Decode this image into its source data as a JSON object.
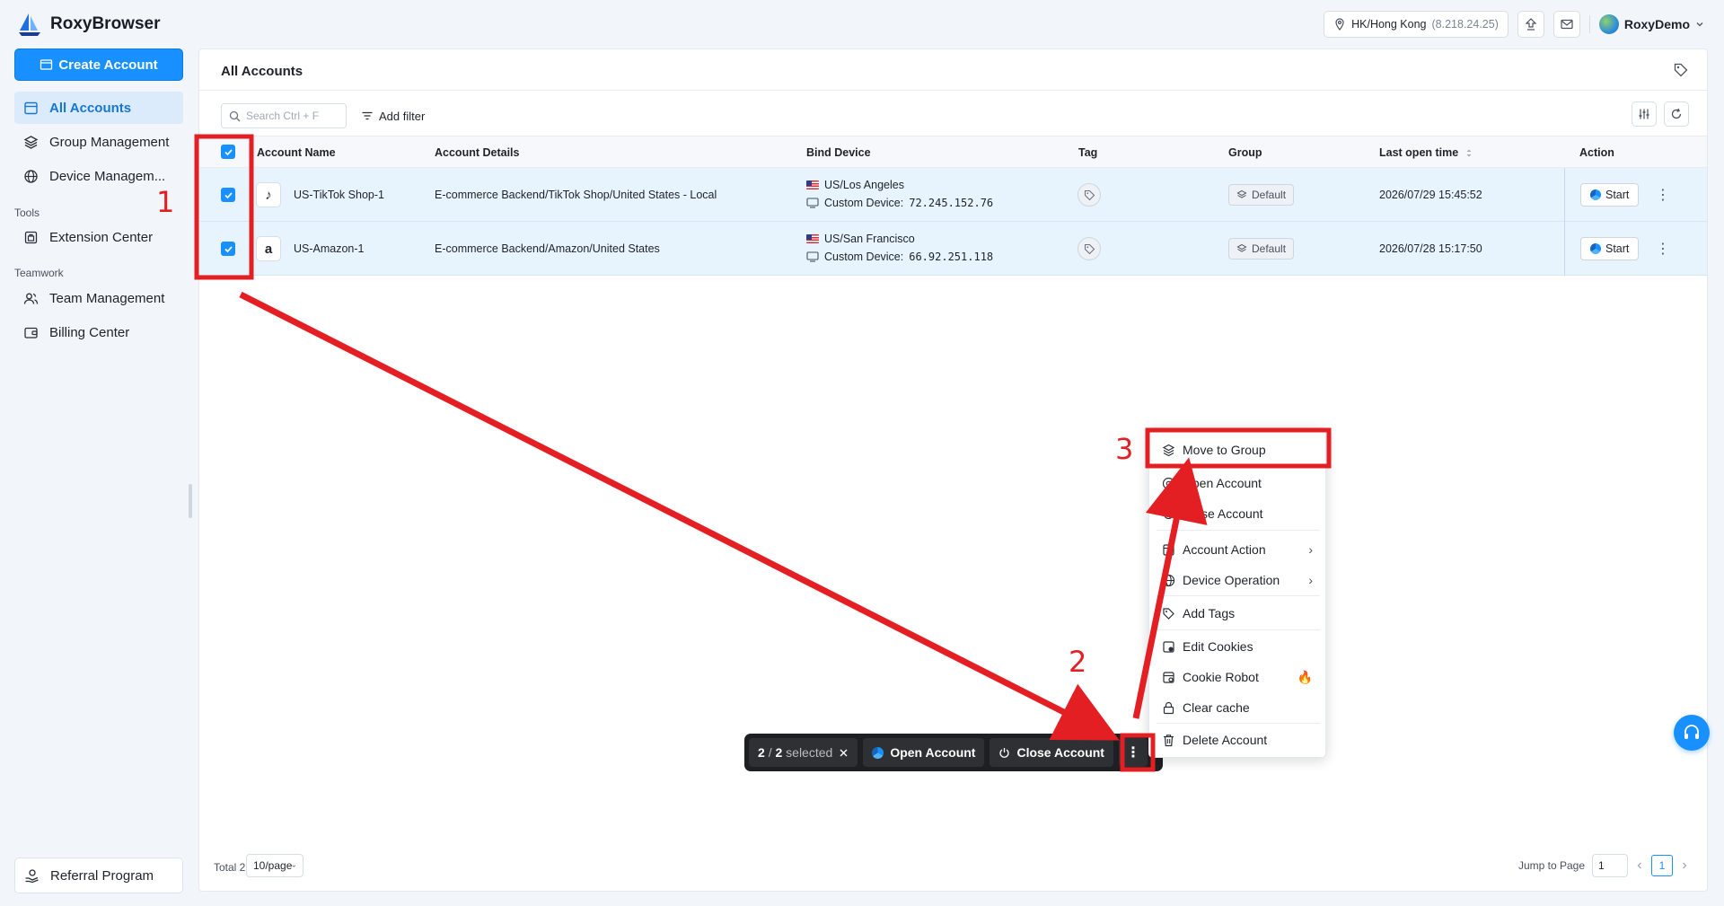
{
  "app": {
    "name": "RoxyBrowser"
  },
  "header": {
    "location": "HK/Hong Kong",
    "ip": "(8.218.24.25)",
    "user_name": "RoxyDemo"
  },
  "sidebar": {
    "create_label": "Create Account",
    "items": [
      {
        "label": "All Accounts",
        "icon": "accounts-icon"
      },
      {
        "label": "Group Management",
        "icon": "layers-icon"
      },
      {
        "label": "Device Managem...",
        "icon": "globe-icon"
      }
    ],
    "tools_title": "Tools",
    "tools_items": [
      {
        "label": "Extension Center",
        "icon": "extension-icon"
      }
    ],
    "teamwork_title": "Teamwork",
    "teamwork_items": [
      {
        "label": "Team Management",
        "icon": "team-icon"
      },
      {
        "label": "Billing Center",
        "icon": "wallet-icon"
      }
    ],
    "referral_label": "Referral Program"
  },
  "main": {
    "title": "All Accounts",
    "search_placeholder": "Search Ctrl + F",
    "add_filter": "Add filter",
    "columns": [
      "Account Name",
      "Account Details",
      "Bind Device",
      "Tag",
      "Group",
      "Last open time",
      "Action"
    ],
    "rows": [
      {
        "name": "US-TikTok Shop-1",
        "platform_glyph": "♪",
        "details": "E-commerce Backend/TikTok Shop/United States - Local",
        "location": "US/Los Angeles",
        "device_label": "Custom Device:",
        "device_ip": "72.245.152.76",
        "group": "Default",
        "last_open": "2026/07/29 15:45:52",
        "action": "Start"
      },
      {
        "name": "US-Amazon-1",
        "platform_glyph": "a",
        "details": "E-commerce Backend/Amazon/United States",
        "location": "US/San Francisco",
        "device_label": "Custom Device:",
        "device_ip": "66.92.251.118",
        "group": "Default",
        "last_open": "2026/07/28 15:17:50",
        "action": "Start"
      }
    ],
    "total": "Total 2",
    "page_size": "10/page",
    "jump_label": "Jump to Page",
    "jump_value": "1",
    "current_page": "1"
  },
  "bulk_bar": {
    "selected": "2",
    "slash": "/",
    "total": "2",
    "selected_word": "selected",
    "open_label": "Open Account",
    "close_label": "Close Account"
  },
  "context_menu": {
    "items": [
      "Move to Group",
      "Open Account",
      "Close Account",
      "Account Action",
      "Device Operation",
      "Add Tags",
      "Edit Cookies",
      "Cookie Robot",
      "Clear cache",
      "Delete Account"
    ]
  },
  "annotations": {
    "step1": "1",
    "step2": "2",
    "step3": "3"
  },
  "colors": {
    "accent": "#1890ff",
    "annotation": "#e41f24",
    "row_selected": "#e7f3fd"
  }
}
